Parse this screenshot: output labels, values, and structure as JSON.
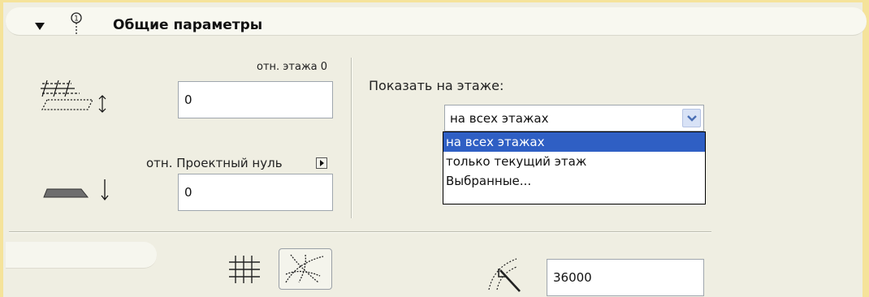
{
  "header": {
    "title": "Общие параметры"
  },
  "elevation": {
    "story_label": "отн. этажа 0",
    "story_value": "0",
    "project_zero_label": "отн. Проектный нуль",
    "project_zero_value": "0"
  },
  "show_on_story": {
    "label": "Показать на этаже:",
    "selected": "на всех этажах",
    "options": [
      "на всех этажах",
      "только текущий этаж",
      "Выбранные..."
    ]
  },
  "bottom": {
    "value": "36000"
  },
  "colors": {
    "highlight": "#2f5fc4",
    "frame": "#f5e39a",
    "panel": "#efeee2"
  },
  "icons": [
    "collapse-arrow-icon",
    "pin-icon",
    "story-elevation-icon",
    "project-zero-icon",
    "grid-icon",
    "curve-grid-icon",
    "arc-radius-icon",
    "chevron-right-icon",
    "chevron-down-icon"
  ]
}
